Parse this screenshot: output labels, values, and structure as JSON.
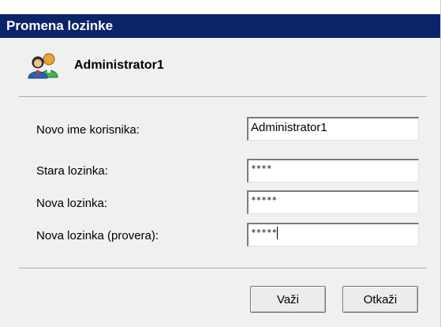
{
  "dialog": {
    "title": "Promena lozinke"
  },
  "user": {
    "icon": "users-icon",
    "name": "Administrator1"
  },
  "form": {
    "username_label": "Novo ime korisnika:",
    "username_value": "Administrator1",
    "old_password_label": "Stara lozinka:",
    "old_password_mask": "****",
    "new_password_label": "Nova lozinka:",
    "new_password_mask": "*****",
    "confirm_password_label": "Nova lozinka (provera):",
    "confirm_password_mask": "*****"
  },
  "buttons": {
    "ok_label": "Važi",
    "cancel_label": "Otkaži"
  },
  "colors": {
    "titlebar": "#0a246a",
    "dialog_bg": "#f0f0f0"
  }
}
